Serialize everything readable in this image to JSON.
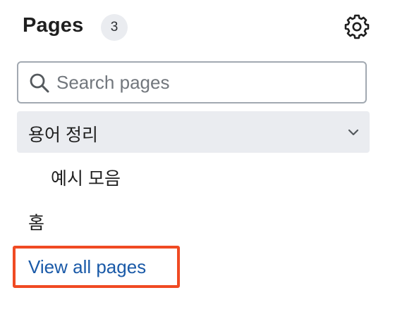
{
  "header": {
    "title": "Pages",
    "count": "3",
    "settings_icon": "gear-icon"
  },
  "search": {
    "placeholder": "Search pages",
    "value": "",
    "icon": "search-icon"
  },
  "pages": {
    "group": {
      "label": "용어 정리",
      "expanded": true,
      "children": [
        {
          "label": "예시 모음"
        }
      ]
    },
    "items": [
      {
        "label": "홈"
      }
    ]
  },
  "footer": {
    "view_all_label": "View all pages"
  },
  "colors": {
    "link": "#1a5aa8",
    "highlight_border": "#f04a23",
    "group_background": "#eaecf0"
  }
}
